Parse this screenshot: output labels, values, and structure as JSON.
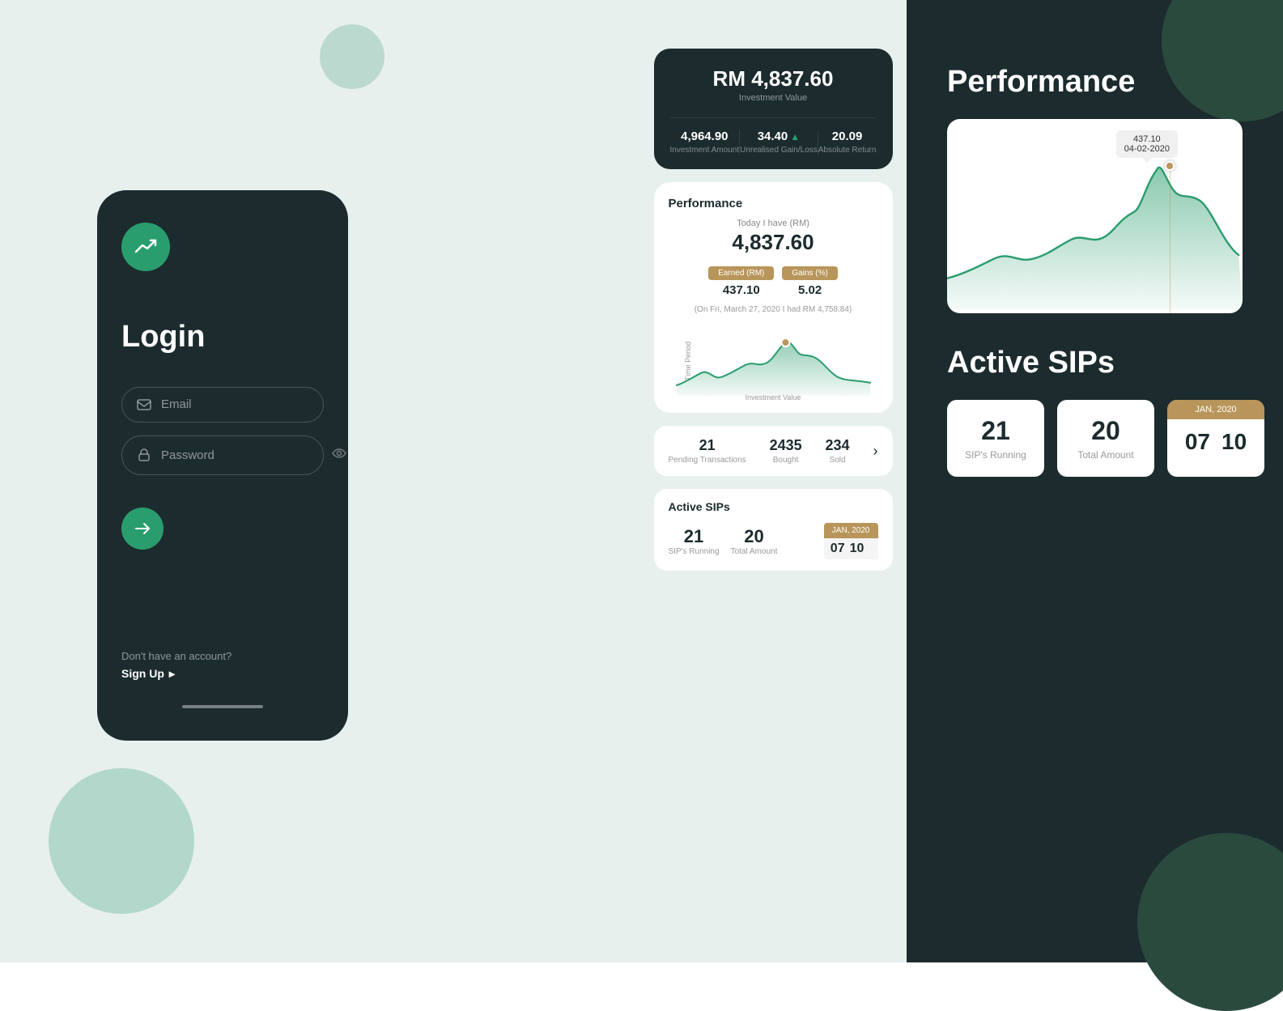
{
  "login": {
    "title": "Login",
    "email_placeholder": "Email",
    "password_placeholder": "Password",
    "arrow_button_label": "→",
    "no_account_text": "Don't have an account?",
    "signup_text": "Sign Up",
    "signup_arrow": "▸"
  },
  "investment": {
    "currency": "RM",
    "amount": "4,837.60",
    "label": "Investment Value",
    "investment_amount": "4,964.90",
    "investment_amount_label": "Investment Amount",
    "unrealised": "34.40",
    "unrealised_label": "Unrealised Gain/Loss",
    "absolute_return": "20.09",
    "absolute_return_label": "Absolute Return"
  },
  "performance": {
    "title": "Performance",
    "today_label": "Today I have (RM)",
    "today_value": "4,837.60",
    "earned_label": "Earned (RM)",
    "earned_value": "437.10",
    "gains_label": "Gains (%)",
    "gains_value": "5.02",
    "note": "(On Fri, March 27, 2020 I had RM 4,758.84)",
    "chart_y_label": "Time Period",
    "chart_x_label": "Investment Value",
    "tooltip_value": "437.10",
    "tooltip_date": "04-02-2020"
  },
  "transactions": {
    "pending": "21",
    "pending_label": "Pending Transactions",
    "bought": "2435",
    "bought_label": "Bought",
    "sold": "234",
    "sold_label": "Sold"
  },
  "active_sips": {
    "title": "Active SIPs",
    "running": "21",
    "running_label": "SIP's Running",
    "total_amount": "20",
    "total_amount_label": "Total Amount",
    "date_tag": "JAN, 2020",
    "date_num1": "07",
    "date_num2": "10"
  },
  "right_panel": {
    "performance_title": "Performance",
    "sips_title": "Active SIPs",
    "chart_tooltip_value": "437.10",
    "chart_tooltip_date": "04-02-2020"
  }
}
